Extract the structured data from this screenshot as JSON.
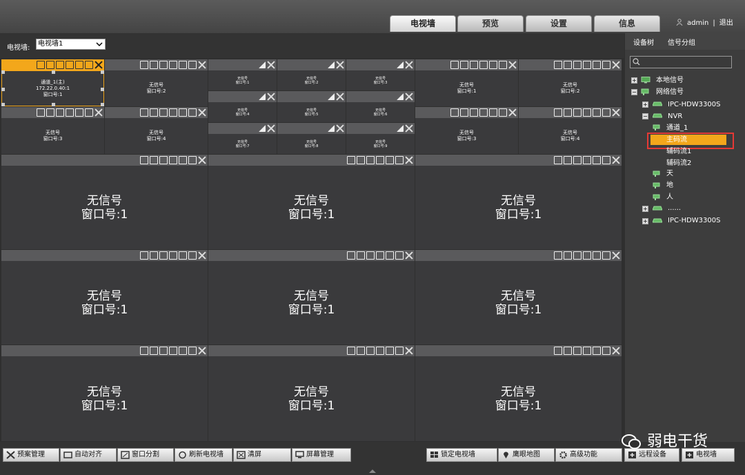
{
  "header": {
    "tabs": [
      "电视墙",
      "预览",
      "设置",
      "信息"
    ],
    "active_tab": "电视墙",
    "user": "admin",
    "logout": "退出"
  },
  "toolbar": {
    "wall_label": "电视墙:",
    "wall_select_value": "电视墙1"
  },
  "wall": {
    "selected_cell": {
      "line1": "通道_1(主)",
      "line2": "172.22.0.40:1",
      "line3": "窗口号:1"
    },
    "small_cells": [
      {
        "line1": "无信号",
        "line2": "窗口号:2"
      },
      {
        "line1": "无信号",
        "line2": "窗口号:3"
      },
      {
        "line1": "无信号",
        "line2": "窗口号:4"
      },
      {
        "line1": "无信号",
        "line2": "窗口号:1"
      },
      {
        "line1": "无信号",
        "line2": "窗口号:2"
      },
      {
        "line1": "无信号",
        "line2": "窗口号:3"
      },
      {
        "line1": "无信号",
        "line2": "窗口号:4"
      }
    ],
    "tiny_cells": [
      {
        "line1": "无信号",
        "line2": "窗口号:1"
      },
      {
        "line1": "无信号",
        "line2": "窗口号:2"
      },
      {
        "line1": "无信号",
        "line2": "窗口号:3"
      },
      {
        "line1": "无信号",
        "line2": "窗口号:4"
      },
      {
        "line1": "无信号",
        "line2": "窗口号:5"
      },
      {
        "line1": "无信号",
        "line2": "窗口号:6"
      },
      {
        "line1": "无信号",
        "line2": "窗口号:7"
      },
      {
        "line1": "无信号",
        "line2": "窗口号:8"
      },
      {
        "line1": "无信号",
        "line2": "窗口号:9"
      }
    ],
    "big_cells": [
      {
        "line1": "无信号",
        "line2": "窗口号:1"
      },
      {
        "line1": "无信号",
        "line2": "窗口号:1"
      },
      {
        "line1": "无信号",
        "line2": "窗口号:1"
      },
      {
        "line1": "无信号",
        "line2": "窗口号:1"
      },
      {
        "line1": "无信号",
        "line2": "窗口号:1"
      },
      {
        "line1": "无信号",
        "line2": "窗口号:1"
      },
      {
        "line1": "无信号",
        "line2": "窗口号:1"
      },
      {
        "line1": "无信号",
        "line2": "窗口号:1"
      },
      {
        "line1": "无信号",
        "line2": "窗口号:1"
      }
    ]
  },
  "sidebar": {
    "tabs": [
      "设备树",
      "信号分组"
    ],
    "tree": {
      "local": "本地信号",
      "network": "网络信号",
      "ipc1": "IPC-HDW3300S",
      "nvr": "NVR",
      "channel": "通道_1",
      "main_stream": "主码流",
      "sub_stream1": "辅码流1",
      "sub_stream2": "辅码流2",
      "tian": "天",
      "di": "地",
      "ren": "人",
      "dots": "......",
      "ipc2": "IPC-HDW3300S"
    }
  },
  "bottom": {
    "left_buttons": [
      "预案管理",
      "自动对齐",
      "窗口分割",
      "刷新电视墙",
      "清屏",
      "屏幕管理"
    ],
    "right_buttons": [
      "锁定电视墙",
      "鹰眼地图",
      "高级功能",
      "远程设备",
      "电视墙"
    ]
  },
  "watermark": "弱电干货",
  "colors": {
    "accent": "#f3a71b",
    "highlight_border": "#e53935",
    "cell_bg": "#3a3a3c",
    "title_bar": "#5a5a5c"
  }
}
